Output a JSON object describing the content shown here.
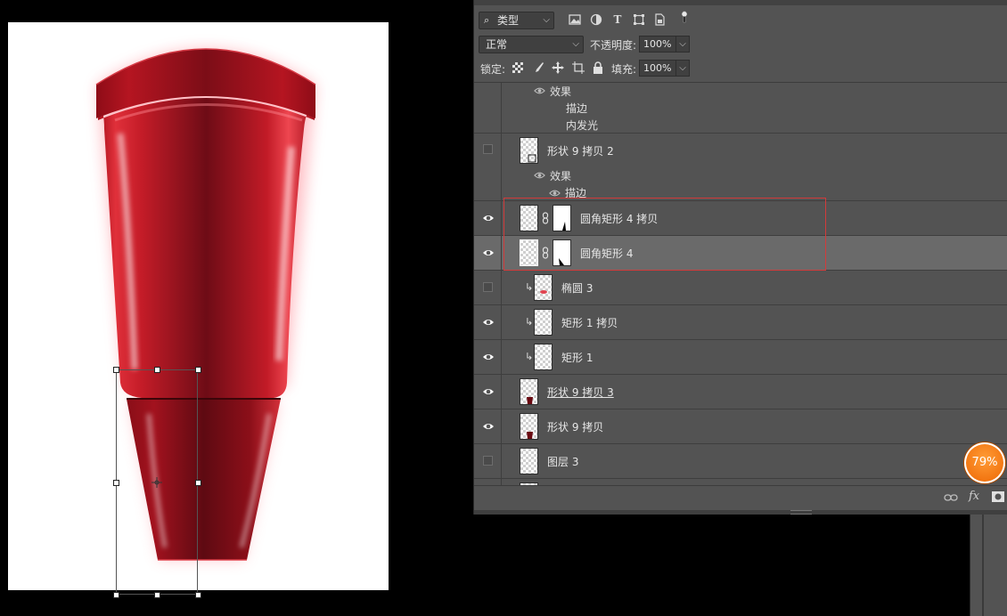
{
  "colors": {
    "app_bg": "#000000",
    "panel_bg": "#535353",
    "selected_row": "#6a6a6a",
    "highlight_border": "#d23b3b",
    "product_red": "#d4202c",
    "product_dark": "#7a0f1a",
    "zoom_badge": "#f27410"
  },
  "toolbar": {
    "filter_kind": "类型",
    "filter_icons": [
      "image-filter-icon",
      "adjustment-filter-icon",
      "type-filter-icon",
      "shape-filter-icon",
      "smart-object-filter-icon",
      "filter-toggle-icon"
    ],
    "blend_mode": "正常",
    "opacity_label": "不透明度:",
    "opacity_value": "100%",
    "lock_label": "锁定:",
    "lock_icons": [
      "lock-transparent-icon",
      "lock-image-icon",
      "lock-position-icon",
      "lock-artboard-icon",
      "lock-all-icon"
    ],
    "fill_label": "填充:",
    "fill_value": "100%"
  },
  "layers": {
    "top_effects": {
      "effects_label": "效果",
      "items": [
        "描边",
        "内发光"
      ]
    },
    "rows": [
      {
        "name": "形状 9 拷贝 2",
        "visible": false,
        "effects_label": "效果",
        "effects": [
          "描边"
        ]
      },
      {
        "name": "圆角矩形 4 拷贝",
        "visible": true,
        "has_mask": true
      },
      {
        "name": "圆角矩形 4",
        "visible": true,
        "has_mask": true,
        "selected": true
      },
      {
        "name": "椭圆 3",
        "visible": false,
        "clipped": true
      },
      {
        "name": "矩形 1 拷贝",
        "visible": true,
        "clipped": true
      },
      {
        "name": "矩形 1",
        "visible": true,
        "clipped": true
      },
      {
        "name": "形状 9 拷贝 3",
        "visible": true
      },
      {
        "name": "形状 9 拷贝",
        "visible": true
      },
      {
        "name": "图层 3",
        "visible": false
      }
    ]
  },
  "footer": {
    "link_icon": "⊝",
    "fx_label": "fx",
    "mask_icon": "layer-mask-icon"
  },
  "zoom_badge": "79%"
}
